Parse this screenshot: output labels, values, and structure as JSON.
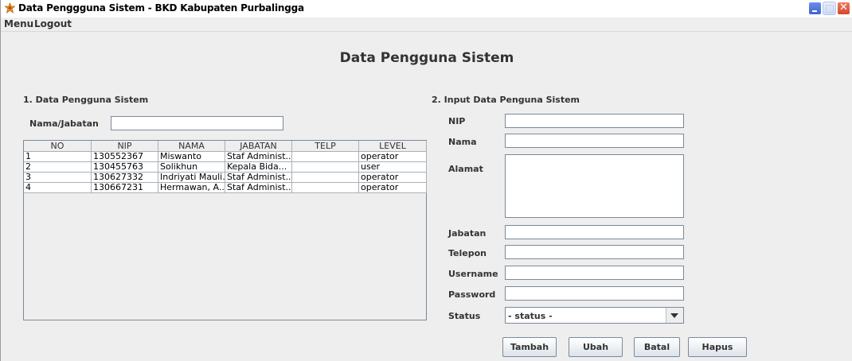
{
  "window": {
    "title": "Data Penggguna Sistem - BKD Kabupaten Purbalingga",
    "close_glyph": "✕"
  },
  "menubar": {
    "items": [
      "Menu",
      "Logout"
    ]
  },
  "heading": "Data Pengguna Sistem",
  "left_section": {
    "label": "1. Data Pengguna Sistem",
    "search_label": "Nama/Jabatan",
    "search_value": "",
    "table": {
      "columns": [
        "NO",
        "NIP",
        "NAMA",
        "JABATAN",
        "TELP",
        "LEVEL"
      ],
      "rows": [
        [
          "1",
          "130552367",
          "Miswanto",
          "Staf Administ...",
          "",
          "operator"
        ],
        [
          "2",
          "130455763",
          "Solikhun",
          "Kepala Bida...",
          "",
          "user"
        ],
        [
          "3",
          "130627332",
          "Indriyati Mauli...",
          "Staf Administ...",
          "",
          "operator"
        ],
        [
          "4",
          "130667231",
          "Hermawan, A...",
          "Staf Administ...",
          "",
          "operator"
        ]
      ]
    }
  },
  "right_section": {
    "label": "2. Input Data Penguna Sistem",
    "fields": {
      "nip": {
        "label": "NIP",
        "value": ""
      },
      "nama": {
        "label": "Nama",
        "value": ""
      },
      "alamat": {
        "label": "Alamat",
        "value": ""
      },
      "jabatan": {
        "label": "Jabatan",
        "value": ""
      },
      "telepon": {
        "label": "Telepon",
        "value": ""
      },
      "username": {
        "label": "Username",
        "value": ""
      },
      "password": {
        "label": "Password",
        "value": ""
      },
      "status": {
        "label": "Status",
        "selected": "- status -"
      }
    },
    "buttons": {
      "tambah": "Tambah",
      "ubah": "Ubah",
      "batal": "Batal",
      "hapus": "Hapus"
    }
  }
}
